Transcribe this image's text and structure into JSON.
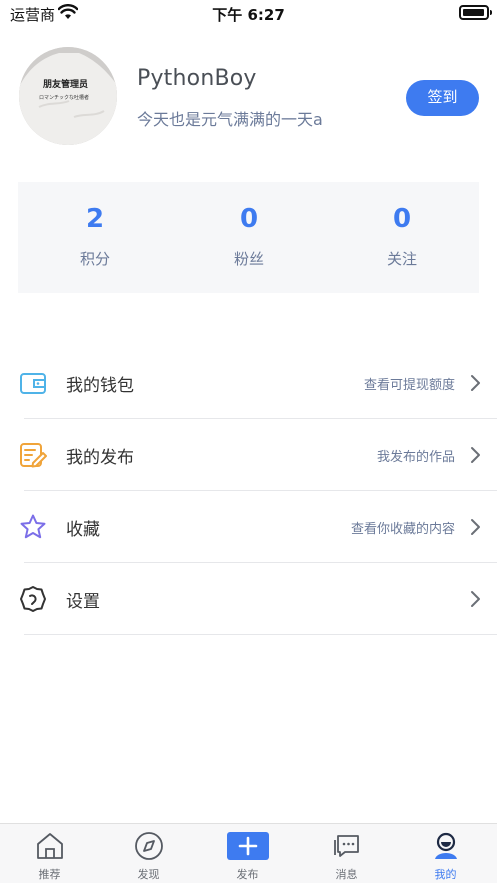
{
  "status_bar": {
    "carrier": "运营商",
    "time": "下午 6:27",
    "battery_level": 0.95
  },
  "profile": {
    "avatar_shirt_text_line1": "朋友管理员",
    "avatar_shirt_text_line2": "ロマンチックな吐槽者",
    "username": "PythonBoy",
    "motto": "今天也是元气满满的一天a",
    "checkin_label": "签到"
  },
  "stats": [
    {
      "value": "2",
      "label": "积分"
    },
    {
      "value": "0",
      "label": "粉丝"
    },
    {
      "value": "0",
      "label": "关注"
    }
  ],
  "menu": [
    {
      "icon": "wallet-icon",
      "title": "我的钱包",
      "hint": "查看可提现额度",
      "color": "#4fb3e8"
    },
    {
      "icon": "edit-icon",
      "title": "我的发布",
      "hint": "我发布的作品",
      "color": "#f0a43a"
    },
    {
      "icon": "star-icon",
      "title": "收藏",
      "hint": "查看你收藏的内容",
      "color": "#7b6ee8"
    },
    {
      "icon": "settings-icon",
      "title": "设置",
      "hint": "",
      "color": "#333333"
    }
  ],
  "tabs": [
    {
      "icon": "home-icon",
      "label": "推荐",
      "active": false
    },
    {
      "icon": "compass-icon",
      "label": "发现",
      "active": false
    },
    {
      "icon": "add-icon",
      "label": "发布",
      "active": false
    },
    {
      "icon": "message-icon",
      "label": "消息",
      "active": false
    },
    {
      "icon": "profile-icon",
      "label": "我的",
      "active": true
    }
  ],
  "colors": {
    "accent": "#3e7bf0",
    "muted_text": "#6b7a99"
  }
}
